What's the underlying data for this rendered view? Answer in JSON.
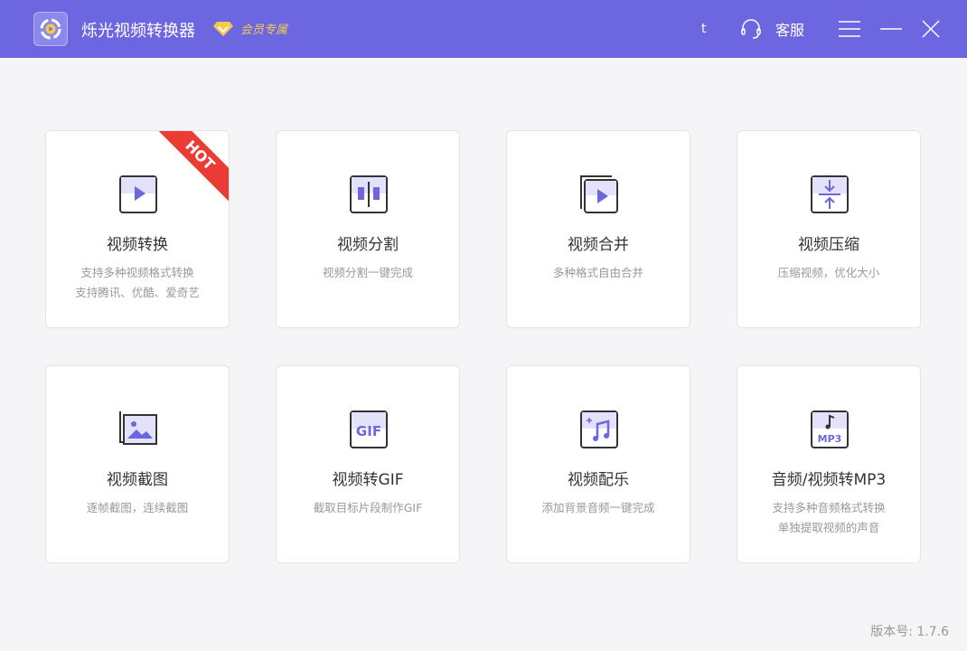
{
  "header": {
    "title": "烁光视频转换器",
    "vip_label": "会员专属",
    "user": "t",
    "service_label": "客服"
  },
  "cards": [
    {
      "title": "视频转换",
      "desc": [
        "支持多种视频格式转换",
        "支持腾讯、优酷、爱奇艺"
      ],
      "badge": "HOT"
    },
    {
      "title": "视频分割",
      "desc": [
        "视频分割一键完成"
      ]
    },
    {
      "title": "视频合并",
      "desc": [
        "多种格式自由合并"
      ]
    },
    {
      "title": "视频压缩",
      "desc": [
        "压缩视频，优化大小"
      ]
    },
    {
      "title": "视频截图",
      "desc": [
        "逐帧截图，连续截图"
      ]
    },
    {
      "title": "视频转GIF",
      "desc": [
        "截取目标片段制作GIF"
      ],
      "icon_text": "GIF"
    },
    {
      "title": "视频配乐",
      "desc": [
        "添加背景音频一键完成"
      ]
    },
    {
      "title": "音频/视频转MP3",
      "desc": [
        "支持多种音频格式转换",
        "单独提取视频的声音"
      ],
      "icon_text": "MP3"
    }
  ],
  "footer": {
    "version": "版本号: 1.7.6"
  },
  "colors": {
    "header": "#6c67e0",
    "accent": "#6c67e0",
    "hot": "#ec3a34",
    "vip": "#f5c94a"
  }
}
